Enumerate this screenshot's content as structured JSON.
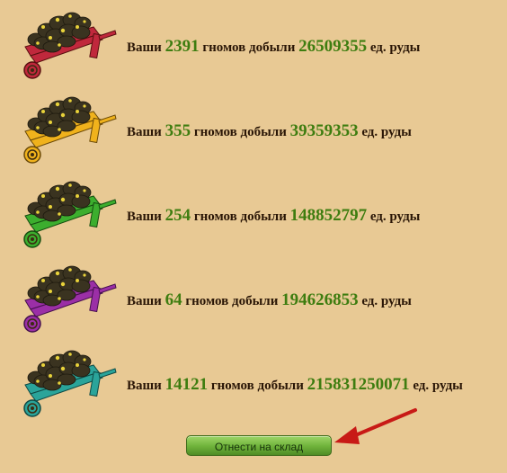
{
  "rows": [
    {
      "prefix": "Ваши",
      "gnomes": "2391",
      "mid": "гномов добыли",
      "ore": "26509355",
      "suffix": "ед. руды",
      "color": "#c0283c"
    },
    {
      "prefix": "Ваши",
      "gnomes": "355",
      "mid": "гномов добыли",
      "ore": "39359353",
      "suffix": "ед. руды",
      "color": "#f0b21c"
    },
    {
      "prefix": "Ваши",
      "gnomes": "254",
      "mid": "гномов добыли",
      "ore": "148852797",
      "suffix": "ед. руды",
      "color": "#3cae2e"
    },
    {
      "prefix": "Ваши",
      "gnomes": "64",
      "mid": "гномов добыли",
      "ore": "194626853",
      "suffix": "ед. руды",
      "color": "#9b2fa6"
    },
    {
      "prefix": "Ваши",
      "gnomes": "14121",
      "mid": "гномов добыли",
      "ore": "215831250071",
      "suffix": "ед. руды",
      "color": "#2aa49a"
    }
  ],
  "store_button": {
    "label": "Отнести на склад"
  },
  "colors": {
    "background": "#e8c994",
    "number": "#3e7d10",
    "text": "#2a1606",
    "arrow": "#c81a16"
  },
  "icons": {
    "wheelbarrow": "wheelbarrow-of-ore-icon",
    "arrow": "pointer-arrow-icon"
  }
}
